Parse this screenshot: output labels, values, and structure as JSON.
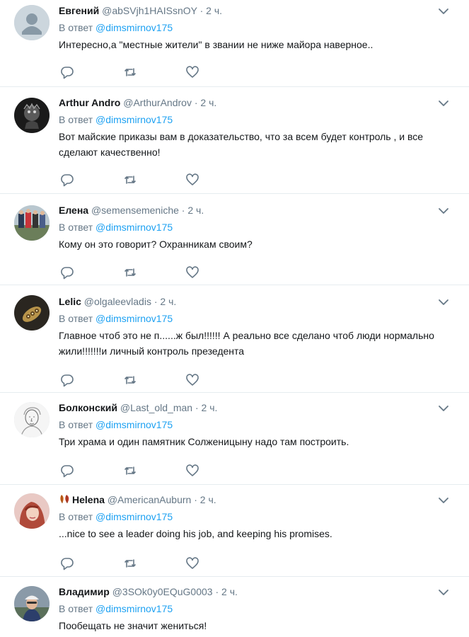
{
  "reply_prefix": "В ответ",
  "colors": {
    "link": "#1da1f2",
    "muted": "#657786",
    "text": "#14171a",
    "divider": "#e6ecf0"
  },
  "icons": {
    "reply": "reply-icon",
    "retweet": "retweet-icon",
    "like": "heart-icon",
    "menu": "chevron-down-icon"
  },
  "tweets": [
    {
      "name": "Евгений",
      "handle": "@abSVjh1HAISsnOY",
      "dot": "·",
      "time": "2 ч.",
      "mention": "@dimsmirnov175",
      "text": "Интересно,а \"местные жители\" в звании не ниже майора наверное.."
    },
    {
      "name": "Arthur Andro",
      "handle": "@ArthurAndrov",
      "dot": "·",
      "time": "2 ч.",
      "mention": "@dimsmirnov175",
      "text": "Вот  майские приказы вам в доказательство, что за всем будет контроль , и все сделают качественно!"
    },
    {
      "name": "Елена",
      "handle": "@semensemeniche",
      "dot": "·",
      "time": "2 ч.",
      "mention": "@dimsmirnov175",
      "text": "Кому он это говорит? Охранникам своим?"
    },
    {
      "name": "Lelic",
      "handle": "@olgaleevladis",
      "dot": "·",
      "time": "2 ч.",
      "mention": "@dimsmirnov175",
      "text": "Главное чтоб это не п......ж был!!!!!! А реально все сделано чтоб люди нормально жили!!!!!!!и личный контроль презедента"
    },
    {
      "name": "Болконский",
      "handle": "@Last_old_man",
      "dot": "·",
      "time": "2 ч.",
      "mention": "@dimsmirnov175",
      "text": "Три храма и один памятник Солженицыну надо там построить."
    },
    {
      "name": "Helena",
      "handle": "@AmericanAuburn",
      "dot": "·",
      "time": "2 ч.",
      "mention": "@dimsmirnov175",
      "text": "...nice to see a leader doing his job, and keeping his promises."
    },
    {
      "name": "Владимир",
      "handle": "@3SOk0y0EQuG0003",
      "dot": "·",
      "time": "2 ч.",
      "mention": "@dimsmirnov175",
      "text": "Пообещать не значит жениться!"
    }
  ]
}
